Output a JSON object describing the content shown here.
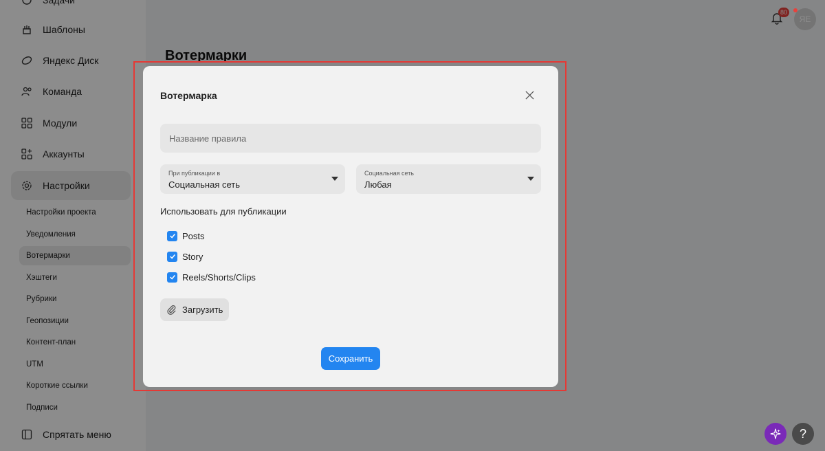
{
  "sidebar": {
    "items": [
      {
        "label": "Задачи",
        "icon": "tasks-icon"
      },
      {
        "label": "Шаблоны",
        "icon": "templates-icon"
      },
      {
        "label": "Яндекс Диск",
        "icon": "yandex-disk-icon"
      },
      {
        "label": "Команда",
        "icon": "team-icon"
      },
      {
        "label": "Модули",
        "icon": "modules-icon"
      },
      {
        "label": "Аккаунты",
        "icon": "accounts-icon"
      },
      {
        "label": "Настройки",
        "icon": "gear-icon"
      }
    ],
    "sub_items": [
      {
        "label": "Настройки проекта"
      },
      {
        "label": "Уведомления"
      },
      {
        "label": "Вотермарки"
      },
      {
        "label": "Хэштеги"
      },
      {
        "label": "Рубрики"
      },
      {
        "label": "Геопозиции"
      },
      {
        "label": "Контент-план"
      },
      {
        "label": "UTM"
      },
      {
        "label": "Короткие ссылки"
      },
      {
        "label": "Подписи"
      }
    ],
    "hide_menu_label": "Спрятать меню"
  },
  "header": {
    "notifications_count": "80",
    "avatar_initials": "ЯЕ"
  },
  "main": {
    "page_title": "Вотермарки"
  },
  "modal": {
    "title": "Вотермарка",
    "name_placeholder": "Название правила",
    "publish_select": {
      "label": "При публикации в",
      "value": "Социальная сеть"
    },
    "network_select": {
      "label": "Социальная сеть",
      "value": "Любая"
    },
    "use_for_label": "Использовать для публикации",
    "checkboxes": [
      {
        "label": "Posts",
        "checked": true
      },
      {
        "label": "Story",
        "checked": true
      },
      {
        "label": "Reels/Shorts/Clips",
        "checked": true
      }
    ],
    "upload_label": "Загрузить",
    "save_label": "Сохранить"
  },
  "colors": {
    "accent": "#2385f0",
    "highlight_outline": "#e53935",
    "badge": "#e8413c",
    "ai_button": "#7a2ab8"
  }
}
